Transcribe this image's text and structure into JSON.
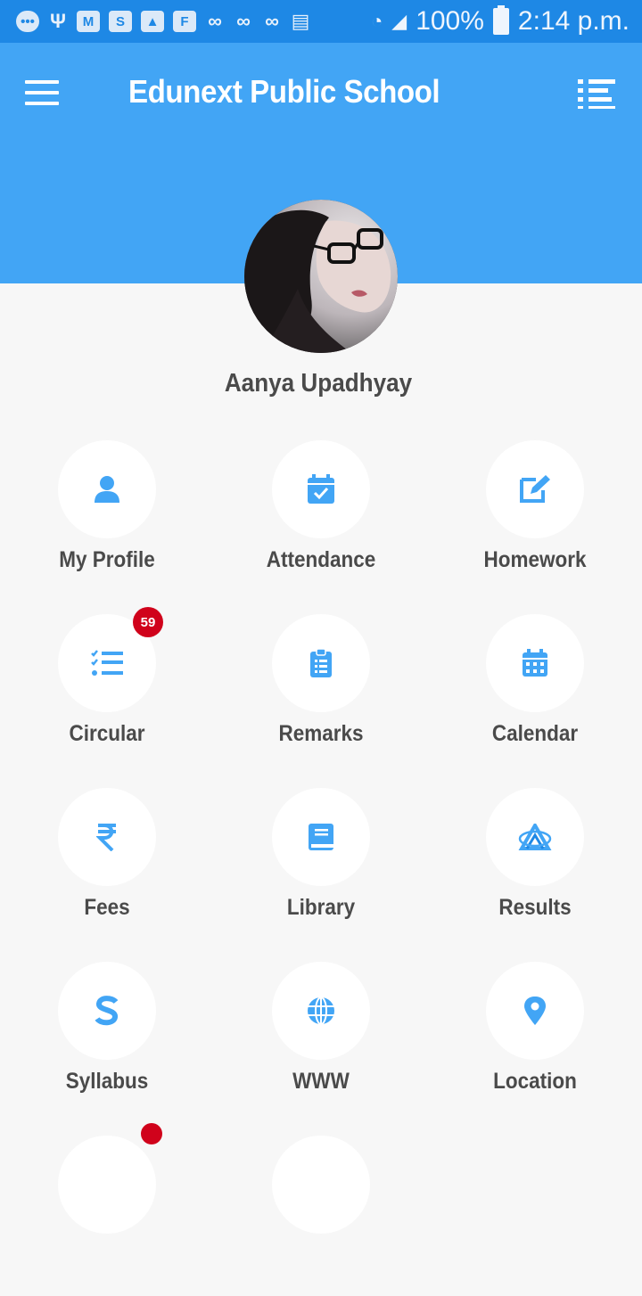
{
  "status_bar": {
    "battery": "100%",
    "time": "2:14 p.m."
  },
  "header": {
    "title": "Edunext Public School"
  },
  "profile": {
    "name": "Aanya Upadhyay"
  },
  "colors": {
    "status_bar": "#1e88e5",
    "header": "#42a5f5",
    "icon": "#42a5f5",
    "text": "#4a4a4a",
    "badge": "#d0021b",
    "background": "#f7f7f7"
  },
  "menu": {
    "items": [
      {
        "label": "My Profile",
        "icon": "person-icon"
      },
      {
        "label": "Attendance",
        "icon": "calendar-check-icon"
      },
      {
        "label": "Homework",
        "icon": "edit-icon"
      },
      {
        "label": "Circular",
        "icon": "checklist-icon",
        "badge": "59"
      },
      {
        "label": "Remarks",
        "icon": "clipboard-icon"
      },
      {
        "label": "Calendar",
        "icon": "calendar-icon"
      },
      {
        "label": "Fees",
        "icon": "rupee-icon"
      },
      {
        "label": "Library",
        "icon": "book-icon"
      },
      {
        "label": "Results",
        "icon": "results-icon"
      },
      {
        "label": "Syllabus",
        "icon": "syllabus-icon"
      },
      {
        "label": "WWW",
        "icon": "globe-icon"
      },
      {
        "label": "Location",
        "icon": "location-pin-icon"
      }
    ]
  }
}
